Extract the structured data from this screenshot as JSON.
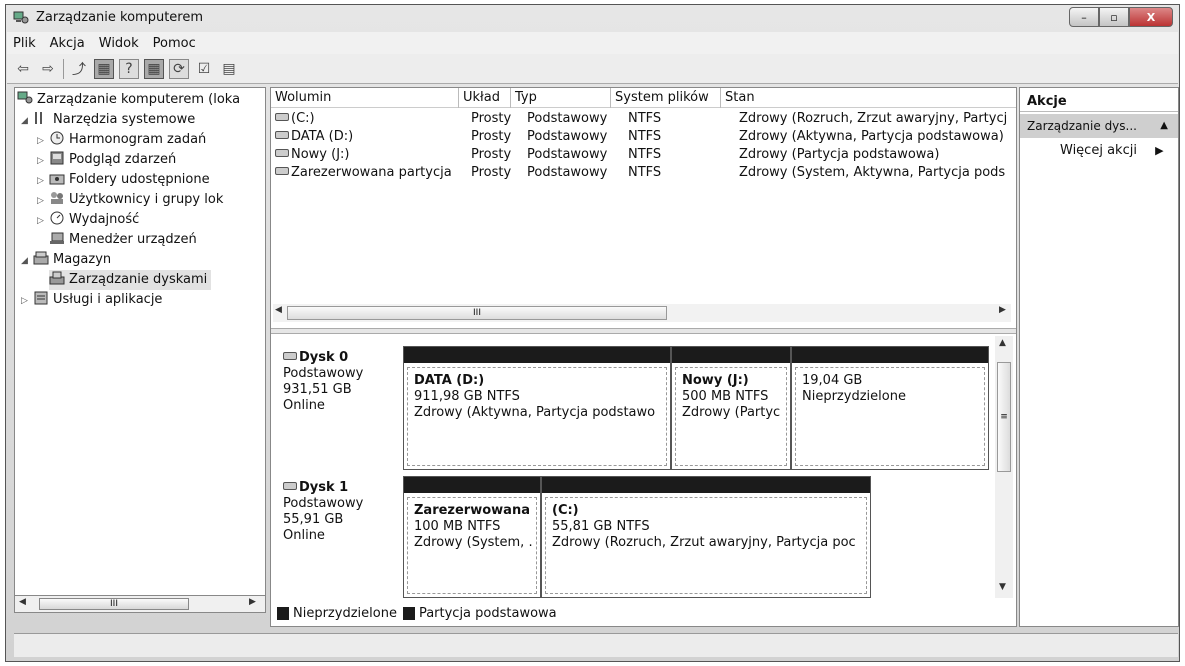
{
  "window": {
    "title": "Zarządzanie komputerem",
    "buttons": {
      "minimize": "–",
      "maximize": "▫",
      "close": "X"
    }
  },
  "menu": [
    "Plik",
    "Akcja",
    "Widok",
    "Pomoc"
  ],
  "toolbar_icons": [
    "back-icon",
    "forward-icon",
    "up-icon",
    "show-hide-console-tree-icon",
    "help-icon",
    "show-hide-action-pane-icon",
    "refresh-icon",
    "properties-icon",
    "settings-icon"
  ],
  "tree": {
    "root": "Zarządzanie komputerem (loka",
    "items": [
      {
        "label": "Narzędzia systemowe",
        "expander": "◢",
        "icon": "tools-icon"
      },
      {
        "label": "Harmonogram zadań",
        "expander": "▷",
        "icon": "clock-icon"
      },
      {
        "label": "Podgląd zdarzeń",
        "expander": "▷",
        "icon": "event-viewer-icon"
      },
      {
        "label": "Foldery udostępnione",
        "expander": "▷",
        "icon": "shared-folder-icon"
      },
      {
        "label": "Użytkownicy i grupy lok",
        "expander": "▷",
        "icon": "users-icon"
      },
      {
        "label": "Wydajność",
        "expander": "▷",
        "icon": "performance-icon"
      },
      {
        "label": "Menedżer urządzeń",
        "expander": "",
        "icon": "device-manager-icon"
      },
      {
        "label": "Magazyn",
        "expander": "◢",
        "icon": "storage-icon"
      },
      {
        "label": "Zarządzanie dyskami",
        "expander": "",
        "icon": "disk-management-icon"
      },
      {
        "label": "Usługi i aplikacje",
        "expander": "▷",
        "icon": "services-icon"
      }
    ],
    "scroll_thumb": "III"
  },
  "volumes": {
    "headers": [
      "Wolumin",
      "Układ",
      "Typ",
      "System plików",
      "Stan"
    ],
    "rows": [
      {
        "name": "(C:)",
        "layout": "Prosty",
        "type": "Podstawowy",
        "fs": "NTFS",
        "status": "Zdrowy (Rozruch, Zrzut awaryjny, Partycj"
      },
      {
        "name": "DATA (D:)",
        "layout": "Prosty",
        "type": "Podstawowy",
        "fs": "NTFS",
        "status": "Zdrowy (Aktywna, Partycja podstawowa)"
      },
      {
        "name": "Nowy (J:)",
        "layout": "Prosty",
        "type": "Podstawowy",
        "fs": "NTFS",
        "status": "Zdrowy (Partycja podstawowa)"
      },
      {
        "name": "Zarezerwowana partycja",
        "layout": "Prosty",
        "type": "Podstawowy",
        "fs": "NTFS",
        "status": "Zdrowy (System, Aktywna, Partycja pods"
      }
    ],
    "scroll_thumb": "III"
  },
  "disks": [
    {
      "name": "Dysk 0",
      "type": "Podstawowy",
      "size": "931,51 GB",
      "state": "Online",
      "partitions": [
        {
          "name": "DATA  (D:)",
          "size": "911,98 GB NTFS",
          "status": "Zdrowy (Aktywna, Partycja podstawo"
        },
        {
          "name": "Nowy  (J:)",
          "size": "500 MB NTFS",
          "status": "Zdrowy (Partyc"
        },
        {
          "name": "",
          "size": "19,04 GB",
          "status": "Nieprzydzielone"
        }
      ]
    },
    {
      "name": "Dysk 1",
      "type": "Podstawowy",
      "size": "55,91 GB",
      "state": "Online",
      "partitions": [
        {
          "name": "Zarezerwowana",
          "size": "100 MB NTFS",
          "status": "Zdrowy (System, ."
        },
        {
          "name": "(C:)",
          "size": "55,81 GB NTFS",
          "status": "Zdrowy (Rozruch, Zrzut awaryjny, Partycja poc"
        }
      ]
    }
  ],
  "disk_scroll_thumb": "≡",
  "legend": [
    "Nieprzydzielone",
    "Partycja podstawowa"
  ],
  "actions": {
    "header": "Akcje",
    "item": "Zarządzanie dys...",
    "item_arrow": "▲",
    "more": "Więcej akcji",
    "more_arrow": "▶"
  }
}
